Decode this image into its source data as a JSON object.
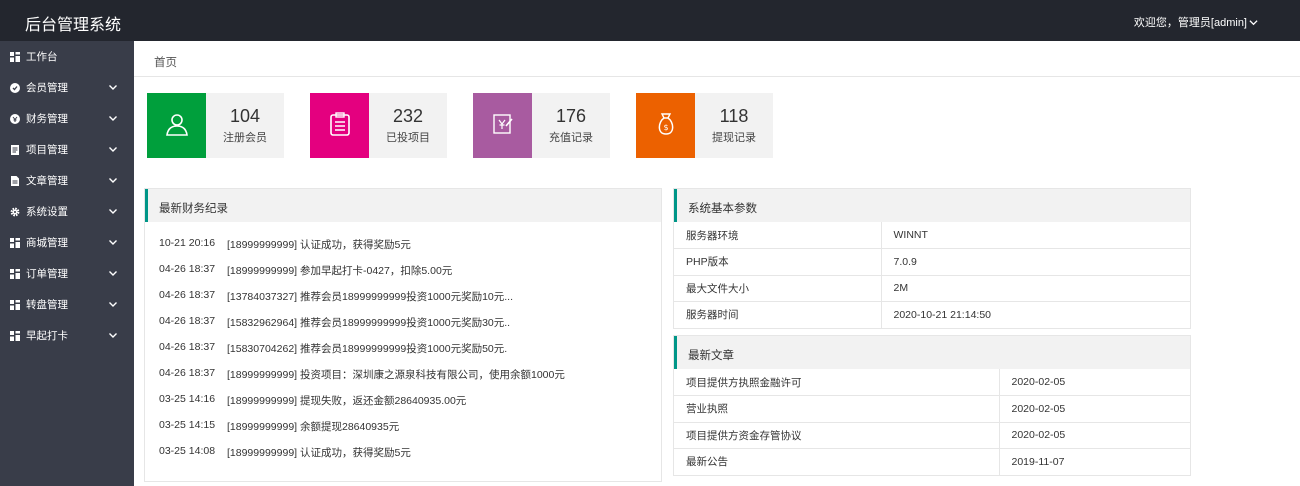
{
  "header": {
    "brand": "后台管理系统",
    "user_greeting": "欢迎您，管理员[admin]"
  },
  "sidebar": {
    "items": [
      {
        "label": "工作台",
        "icon": "dashboard-icon",
        "has_submenu": false
      },
      {
        "label": "会员管理",
        "icon": "user-circle-icon",
        "has_submenu": true
      },
      {
        "label": "财务管理",
        "icon": "finance-circle-icon",
        "has_submenu": true
      },
      {
        "label": "项目管理",
        "icon": "project-doc-icon",
        "has_submenu": true
      },
      {
        "label": "文章管理",
        "icon": "article-doc-icon",
        "has_submenu": true
      },
      {
        "label": "系统设置",
        "icon": "gear-icon",
        "has_submenu": true
      },
      {
        "label": "商城管理",
        "icon": "grid-icon",
        "has_submenu": true
      },
      {
        "label": "订单管理",
        "icon": "grid-icon",
        "has_submenu": true
      },
      {
        "label": "转盘管理",
        "icon": "grid-icon",
        "has_submenu": true
      },
      {
        "label": "早起打卡",
        "icon": "grid-icon",
        "has_submenu": true
      }
    ]
  },
  "breadcrumb": "首页",
  "stats": [
    {
      "value": "104",
      "label": "注册会员",
      "color": "#009f3c",
      "icon": "user-icon"
    },
    {
      "value": "232",
      "label": "已投项目",
      "color": "#e4007f",
      "icon": "clipboard-icon"
    },
    {
      "value": "176",
      "label": "充值记录",
      "color": "#a85ba0",
      "icon": "recharge-icon"
    },
    {
      "value": "118",
      "label": "提现记录",
      "color": "#ec6100",
      "icon": "money-bag-icon"
    }
  ],
  "finance_panel": {
    "title": "最新财务纪录",
    "rows": [
      {
        "time": "10-21 20:16",
        "text": "[18999999999] 认证成功，获得奖励5元"
      },
      {
        "time": "04-26 18:37",
        "text": "[18999999999] 参加早起打卡-0427，扣除5.00元"
      },
      {
        "time": "04-26 18:37",
        "text": "[13784037327] 推荐会员18999999999投资1000元奖励10元..."
      },
      {
        "time": "04-26 18:37",
        "text": "[15832962964] 推荐会员18999999999投资1000元奖励30元.."
      },
      {
        "time": "04-26 18:37",
        "text": "[15830704262] 推荐会员18999999999投资1000元奖励50元."
      },
      {
        "time": "04-26 18:37",
        "text": "[18999999999] 投资项目：深圳康之源泉科技有限公司，使用余额1000元"
      },
      {
        "time": "03-25 14:16",
        "text": "[18999999999] 提现失败，返还金额28640935.00元"
      },
      {
        "time": "03-25 14:15",
        "text": "[18999999999] 余额提现28640935元"
      },
      {
        "time": "03-25 14:08",
        "text": "[18999999999] 认证成功，获得奖励5元"
      }
    ]
  },
  "system_panel": {
    "title": "系统基本参数",
    "rows": [
      {
        "key": "服务器环境",
        "value": "WINNT"
      },
      {
        "key": "PHP版本",
        "value": "7.0.9"
      },
      {
        "key": "最大文件大小",
        "value": "2M"
      },
      {
        "key": "服务器时间",
        "value": "2020-10-21 21:14:50"
      }
    ]
  },
  "articles_panel": {
    "title": "最新文章",
    "rows": [
      {
        "title": "项目提供方执照金融许可",
        "date": "2020-02-05"
      },
      {
        "title": "营业执照",
        "date": "2020-02-05"
      },
      {
        "title": "项目提供方资金存管协议",
        "date": "2020-02-05"
      },
      {
        "title": "最新公告",
        "date": "2019-11-07"
      }
    ]
  },
  "colors": {
    "topbar": "#23262e",
    "sidebar": "#393d49",
    "accent": "#009688",
    "panel_header": "#f2f2f2"
  }
}
